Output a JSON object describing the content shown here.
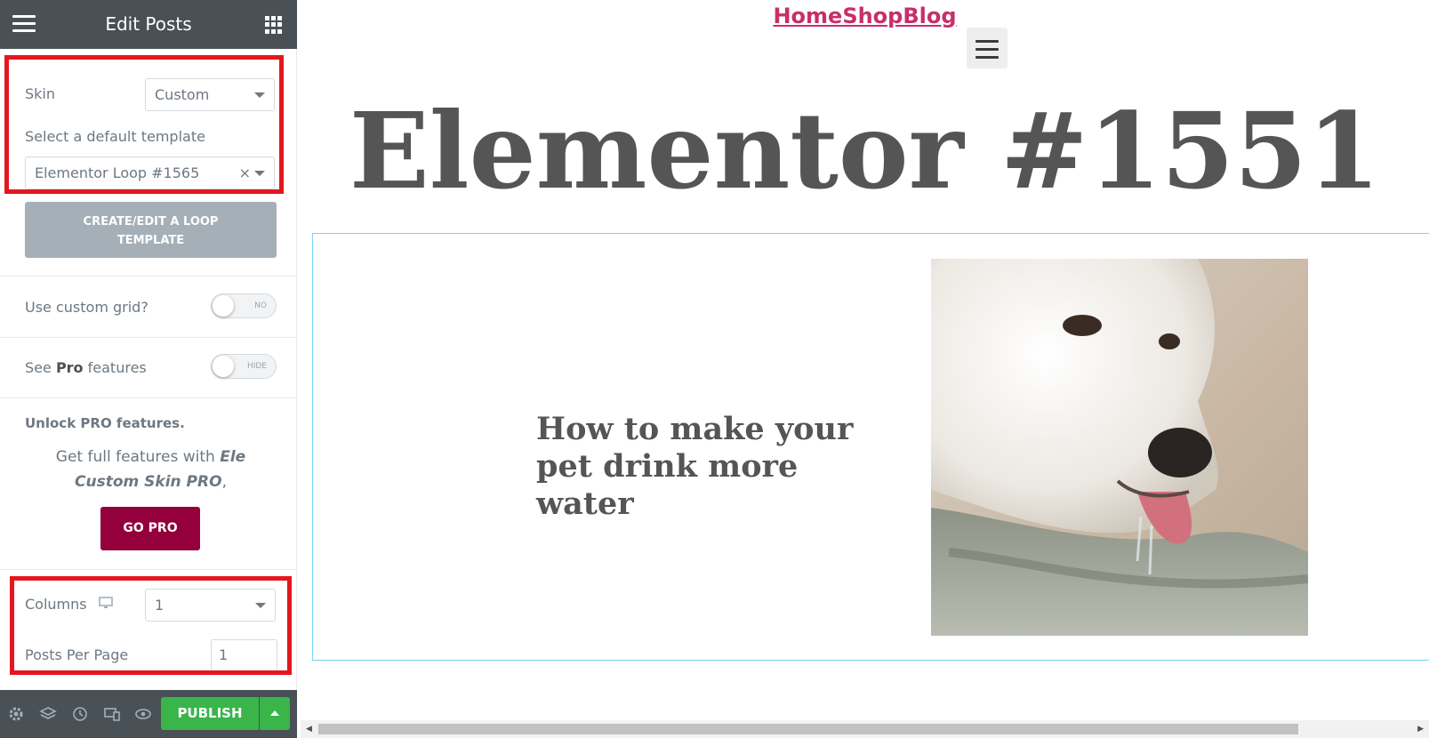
{
  "editor": {
    "title": "Edit Posts",
    "skin": {
      "label": "Skin",
      "value": "Custom"
    },
    "template": {
      "label": "Select a default template",
      "value": "Elementor Loop #1565",
      "clear_icon": "×"
    },
    "loop_button": {
      "line1": "CREATE/EDIT A LOOP",
      "line2": "TEMPLATE"
    },
    "custom_grid": {
      "label": "Use custom grid?",
      "state": "NO"
    },
    "pro_features": {
      "label_pre": "See",
      "label_bold": "Pro",
      "label_post": "features",
      "state": "HIDE"
    },
    "unlock": {
      "title": "Unlock PRO features.",
      "text_pre": "Get full features with",
      "text_em": "Ele Custom Skin PRO",
      "text_post": ","
    },
    "go_pro_label": "GO PRO",
    "columns": {
      "label": "Columns",
      "value": "1"
    },
    "posts_per_page": {
      "label": "Posts Per Page",
      "value": "1"
    },
    "footer": {
      "publish_label": "PUBLISH",
      "icons": [
        "settings-icon",
        "layers-icon",
        "history-icon",
        "responsive-icon",
        "preview-eye-icon"
      ]
    },
    "collapse_icon": "‹"
  },
  "preview": {
    "site_title": "HomeShopBlog",
    "page_title": "Elementor #1551",
    "post": {
      "title": "How to make your pet drink more water",
      "image_alt": "white dog drinking water"
    },
    "scroll_left": "◀",
    "scroll_right": "▶"
  },
  "colors": {
    "header_bg": "#495157",
    "highlight_border": "#e4161f",
    "go_pro_bg": "#93003c",
    "publish_bg": "#39b54a",
    "site_title": "#c72f69"
  }
}
